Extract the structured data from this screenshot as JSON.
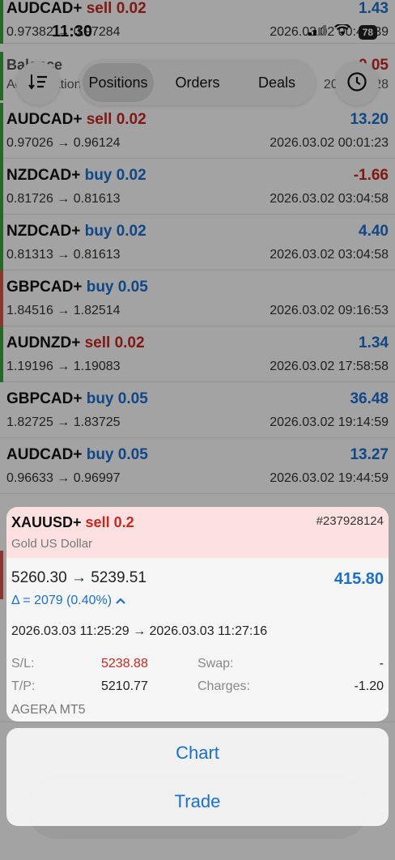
{
  "status_bar": {
    "time": "11:30",
    "battery": "78"
  },
  "toolbar": {
    "tabs": [
      {
        "label": "Positions",
        "active": true
      },
      {
        "label": "Orders",
        "active": false
      },
      {
        "label": "Deals",
        "active": false
      }
    ],
    "sort_icon": "sort-icon",
    "history_icon": "clock-icon"
  },
  "top_partial_row": {
    "symbol": "AUDCAD+",
    "direction": "sell",
    "volume": "0.02",
    "prices": "0.97382 → 0.97284",
    "profit": "1.43",
    "time": "2026.03.02 00:43:39"
  },
  "balance_row": {
    "label": "Balance",
    "sub": "Accreditation",
    "value": "0.05",
    "date": "2026.03.28"
  },
  "positions": [
    {
      "symbol": "AUDCAD+",
      "direction": "sell",
      "volume": "0.02",
      "prices": "0.97026 → 0.96124",
      "profit": "13.20",
      "time": "2026.03.02 00:01:23",
      "bar": "#3aa23a"
    },
    {
      "symbol": "NZDCAD+",
      "direction": "buy",
      "volume": "0.02",
      "prices": "0.81726 → 0.81613",
      "profit": "-1.66",
      "time": "2026.03.02 03:04:58",
      "bar": "#3aa23a"
    },
    {
      "symbol": "NZDCAD+",
      "direction": "buy",
      "volume": "0.02",
      "prices": "0.81313 → 0.81613",
      "profit": "4.40",
      "time": "2026.03.02 03:04:58",
      "bar": "#3aa23a"
    },
    {
      "symbol": "GBPCAD+",
      "direction": "buy",
      "volume": "0.05",
      "prices": "1.84516 → 1.82514",
      "profit": "",
      "time": "2026.03.02 09:16:53",
      "bar": "#d9534f"
    },
    {
      "symbol": "AUDNZD+",
      "direction": "sell",
      "volume": "0.02",
      "prices": "1.19196 → 1.19083",
      "profit": "1.34",
      "time": "2026.03.02 17:58:58",
      "bar": "#3aa23a"
    },
    {
      "symbol": "GBPCAD+",
      "direction": "buy",
      "volume": "0.05",
      "prices": "1.82725 → 1.83725",
      "profit": "36.48",
      "time": "2026.03.02 19:14:59",
      "bar": ""
    },
    {
      "symbol": "AUDCAD+",
      "direction": "buy",
      "volume": "0.05",
      "prices": "0.96633 → 0.96997",
      "profit": "13.27",
      "time": "2026.03.02 19:44:59",
      "bar": ""
    }
  ],
  "detail": {
    "symbol": "XAUUSD+",
    "direction": "sell",
    "volume": "0.2",
    "ticket": "#237928124",
    "description": "Gold US Dollar",
    "prices": "5260.30 → 5239.51",
    "profit": "415.80",
    "delta": "Δ = 2079 (0.40%)",
    "times": "2026.03.03 11:25:29 → 2026.03.03 11:27:16",
    "sl_label": "S/L:",
    "sl_value": "5238.88",
    "tp_label": "T/P:",
    "tp_value": "5210.77",
    "swap_label": "Swap:",
    "swap_value": "-",
    "charges_label": "Charges:",
    "charges_value": "-1.20",
    "broker": "AGERA MT5"
  },
  "sheet": {
    "chart": "Chart",
    "trade": "Trade"
  },
  "colors": {
    "accent": "#1a6fd0",
    "sell": "#c8281e",
    "header_pink": "#fde1e1"
  }
}
